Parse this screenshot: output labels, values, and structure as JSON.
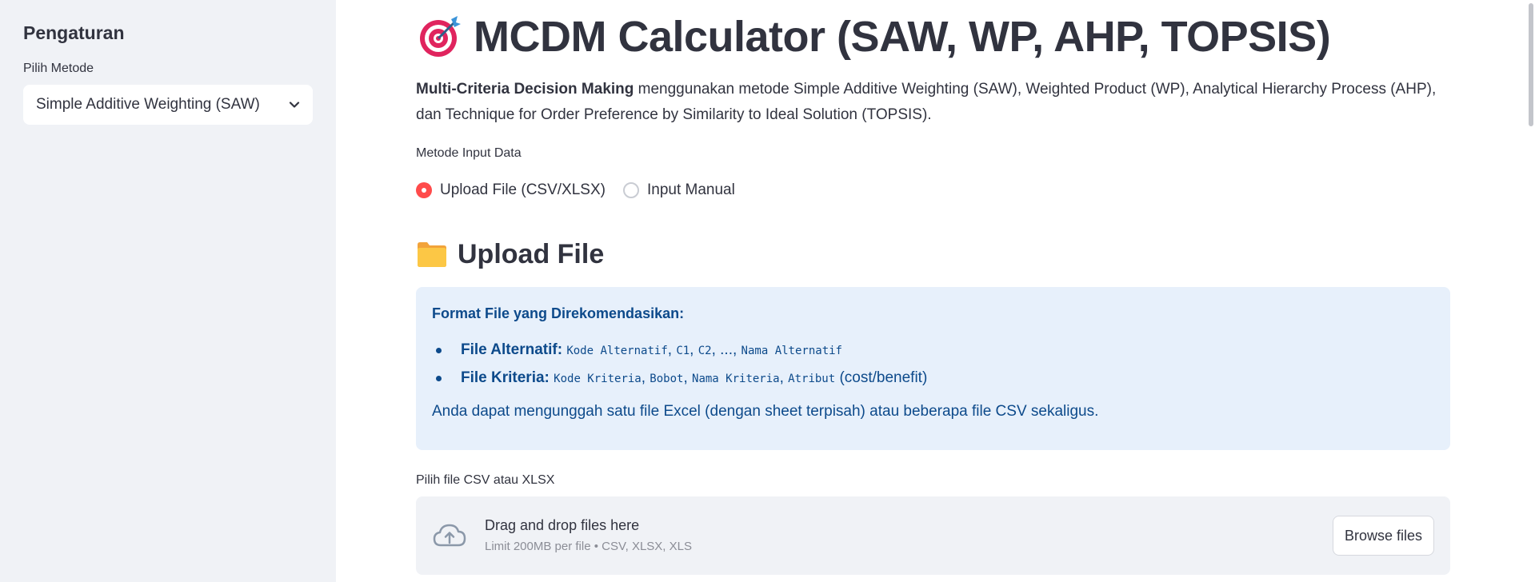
{
  "sidebar": {
    "title": "Pengaturan",
    "method_label": "Pilih Metode",
    "method_selected": "Simple Additive Weighting (SAW)"
  },
  "main": {
    "title": "MCDM Calculator (SAW, WP, AHP, TOPSIS)",
    "title_icon": "target-dart-icon",
    "intro_bold": "Multi-Criteria Decision Making",
    "intro_rest": " menggunakan metode Simple Additive Weighting (SAW), Weighted Product (WP), Analytical Hierarchy Process (AHP), dan Technique for Order Preference by Similarity to Ideal Solution (TOPSIS).",
    "input_method_label": "Metode Input Data",
    "radio_options": [
      "Upload File (CSV/XLSX)",
      "Input Manual"
    ],
    "radio_selected": "Upload File (CSV/XLSX)",
    "section_title": "Upload File",
    "section_icon": "folder-icon",
    "info": {
      "heading": "Format File yang Direkomendasikan:",
      "alt_label": "File Alternatif:",
      "alt_code1": "Kode Alternatif",
      "alt_sep1": ", ",
      "alt_code2": "C1",
      "alt_sep2": ", ",
      "alt_code3": "C2",
      "alt_sep3": ", ..., ",
      "alt_code4": "Nama Alternatif",
      "crit_label": "File Kriteria:",
      "crit_code1": "Kode Kriteria",
      "crit_sep1": ", ",
      "crit_code2": "Bobot",
      "crit_sep2": ", ",
      "crit_code3": "Nama Kriteria",
      "crit_sep3": ", ",
      "crit_code4": "Atribut",
      "crit_tail": " (cost/benefit)",
      "footer": "Anda dapat mengunggah satu file Excel (dengan sheet terpisah) atau beberapa file CSV sekaligus."
    },
    "uploader": {
      "label": "Pilih file CSV atau XLSX",
      "drop_text": "Drag and drop files here",
      "limit_text": "Limit 200MB per file • CSV, XLSX, XLS",
      "browse_label": "Browse files"
    }
  },
  "colors": {
    "accent": "#ff4b4b",
    "sidebar_bg": "#f0f2f6",
    "info_bg": "#e7f0fb",
    "info_text": "#0d4a8b",
    "text": "#31333f"
  }
}
